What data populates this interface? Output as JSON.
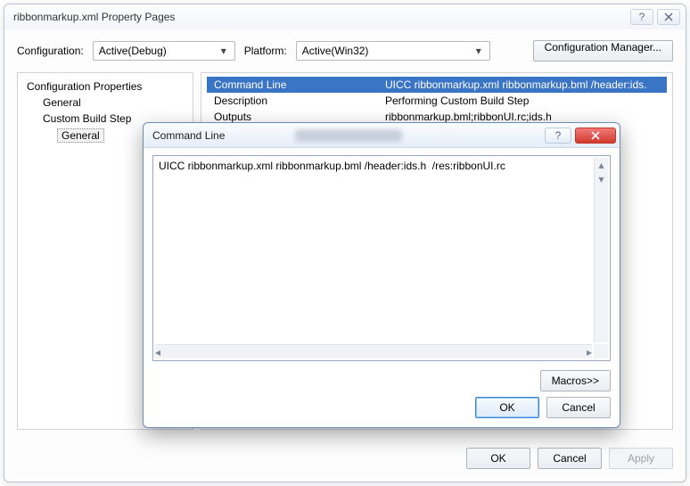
{
  "main": {
    "title": "ribbonmarkup.xml Property Pages",
    "config_label": "Configuration:",
    "config_value": "Active(Debug)",
    "platform_label": "Platform:",
    "platform_value": "Active(Win32)",
    "cfg_mgr": "Configuration Manager...",
    "tree": {
      "root": "Configuration Properties",
      "general": "General",
      "custom_build_step": "Custom Build Step",
      "custom_general": "General"
    },
    "props": {
      "command_line_label": "Command Line",
      "command_line_value": "UICC ribbonmarkup.xml ribbonmarkup.bml /header:ids.",
      "description_label": "Description",
      "description_value": "Performing Custom Build Step",
      "outputs_label": "Outputs",
      "outputs_value": "ribbonmarkup.bml;ribbonUI.rc;ids.h"
    },
    "buttons": {
      "ok": "OK",
      "cancel": "Cancel",
      "apply": "Apply"
    }
  },
  "modal": {
    "title": "Command Line",
    "text": "UICC ribbonmarkup.xml ribbonmarkup.bml /header:ids.h  /res:ribbonUI.rc",
    "macros": "Macros>>",
    "ok": "OK",
    "cancel": "Cancel"
  }
}
